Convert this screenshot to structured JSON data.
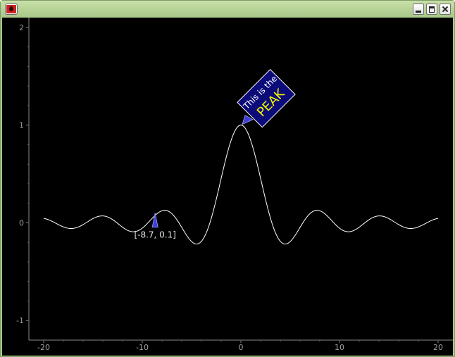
{
  "window": {
    "icons": [
      "app-icon",
      "minimize-icon",
      "maximize-icon",
      "close-icon"
    ]
  },
  "chart_data": {
    "type": "line",
    "title": "",
    "xlabel": "",
    "ylabel": "",
    "xlim": [
      -21.5,
      21.5
    ],
    "ylim": [
      -1.2,
      2.1
    ],
    "grid": false,
    "background": "#000000",
    "line_color": "#ffffff",
    "x_ticks": [
      -20,
      -10,
      0,
      10,
      20
    ],
    "x_tick_labels": [
      "-20",
      "-10",
      "0",
      "10",
      "20"
    ],
    "y_ticks": [
      -1,
      0,
      1,
      2
    ],
    "y_tick_labels": [
      "-1",
      "0",
      "1",
      "2"
    ],
    "series": [
      {
        "function": "sin(x)/x",
        "x": [
          -20,
          -19,
          -18,
          -17,
          -16,
          -15,
          -14,
          -13,
          -12,
          -11,
          -10,
          -9,
          -8,
          -7,
          -6,
          -5,
          -4,
          -3,
          -2,
          -1,
          0,
          1,
          2,
          3,
          4,
          5,
          6,
          7,
          8,
          9,
          10,
          11,
          12,
          13,
          14,
          15,
          16,
          17,
          18,
          19,
          20
        ],
        "y": [
          0.05,
          0.008,
          -0.042,
          -0.057,
          -0.018,
          0.043,
          0.07,
          0.032,
          -0.045,
          -0.091,
          -0.054,
          0.046,
          0.124,
          0.094,
          -0.047,
          -0.192,
          -0.189,
          0.047,
          0.455,
          0.841,
          1.0,
          0.841,
          0.455,
          0.047,
          -0.189,
          -0.192,
          -0.047,
          0.094,
          0.124,
          0.046,
          -0.054,
          -0.091,
          -0.045,
          0.032,
          0.07,
          0.043,
          -0.018,
          -0.057,
          -0.042,
          0.008,
          0.05
        ]
      }
    ],
    "annotations": [
      {
        "label": "[-8.7, 0.1]",
        "x": -8.7,
        "y": 0.1,
        "marker_color": "#3f3fd6"
      },
      {
        "small_text": "This is the",
        "big_text": "PEAK",
        "x": 0,
        "y": 1.0,
        "box_fill": "#0b0b7a",
        "box_border": "#ffffff",
        "big_text_color": "#f3f300"
      }
    ]
  }
}
